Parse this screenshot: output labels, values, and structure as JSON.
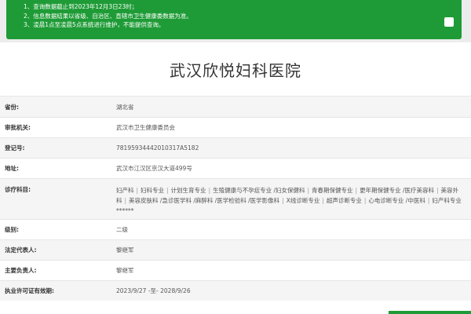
{
  "notice": {
    "lines": [
      "1、查询数据截止到2023年12月3日23时；",
      "2、信息数据结果以省级、自治区、直辖市卫生健康委数据为准。",
      "3、凌晨1点至凌晨5点系统进行维护，不能提供查询。"
    ]
  },
  "hospital": {
    "name": "武汉欣悦妇科医院"
  },
  "fields": {
    "province": {
      "label": "省份:",
      "value": "湖北省"
    },
    "authority": {
      "label": "审批机关:",
      "value": "武汉市卫生健康委员会"
    },
    "reg_no": {
      "label": "登记号:",
      "value": "78195934442010317A5182"
    },
    "address": {
      "label": "地址:",
      "value": "武汉市江汉区京汉大道499号"
    },
    "subjects": {
      "label": "诊疗科目:",
      "items": [
        "妇产科",
        "妇科专业",
        "计划生育专业",
        "生殖健康与不孕症专业 /妇女保健科",
        "青春期保健专业",
        "更年期保健专业 /医疗美容科",
        "美容外科",
        "美容皮肤科 /急诊医学科 /麻醉科 /医学检验科 /医学影像科",
        "X线诊断专业",
        "超声诊断专业",
        "心电诊断专业 /中医科",
        "妇产科专业"
      ],
      "tail": "******"
    },
    "level": {
      "label": "级别:",
      "value": "二级"
    },
    "legal_rep": {
      "label": "法定代表人:",
      "value": "黎继军"
    },
    "principal": {
      "label": "主要负责人:",
      "value": "黎继军"
    },
    "license": {
      "label": "执业许可证有效期:",
      "value": "2023/9/27 -至- 2028/9/26"
    }
  }
}
